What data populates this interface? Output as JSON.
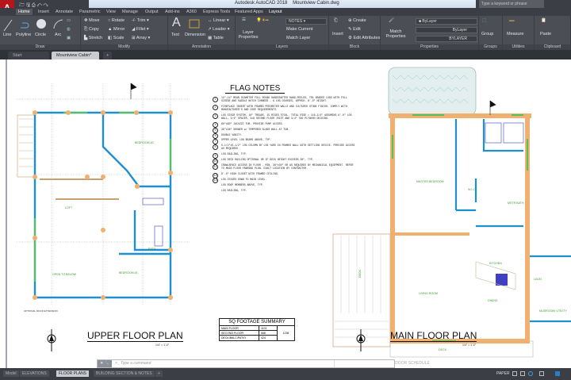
{
  "window": {
    "title": "Autodesk AutoCAD 2018",
    "file": "Mountview Cabin.dwg",
    "search_placeholder": "Type a keyword or phrase",
    "app_letter": "A"
  },
  "ribbon_tabs": [
    "Home",
    "Insert",
    "Annotate",
    "Parametric",
    "View",
    "Manage",
    "Output",
    "Add-ins",
    "A360",
    "Express Tools",
    "Featured Apps",
    "Layout"
  ],
  "panels": {
    "draw": {
      "label": "Draw",
      "buttons": [
        "Line",
        "Polyline",
        "Circle",
        "Arc"
      ]
    },
    "modify": {
      "label": "Modify",
      "buttons": [
        "Move",
        "Rotate",
        "Trim",
        "Copy",
        "Mirror",
        "Fillet",
        "Stretch",
        "Scale",
        "Array"
      ]
    },
    "annotation": {
      "label": "Annotation",
      "buttons": [
        "Text",
        "Dimension",
        "Linear",
        "Leader",
        "Table"
      ]
    },
    "layers": {
      "label": "Layers",
      "buttons": [
        "Layer Properties",
        "Make Current",
        "Match Layer"
      ],
      "layer_value": "NOTES"
    },
    "block": {
      "label": "Block",
      "buttons": [
        "Insert",
        "Create",
        "Edit",
        "Edit Attributes"
      ]
    },
    "properties": {
      "label": "Properties",
      "buttons": [
        "Match Properties"
      ],
      "color": "ByLayer",
      "linetype": "ByLayer",
      "lineweight": "BYLAYER"
    },
    "groups": {
      "label": "Groups",
      "buttons": [
        "Group"
      ]
    },
    "utilities": {
      "label": "Utilities",
      "buttons": [
        "Measure"
      ]
    },
    "clipboard": {
      "label": "Clipboard",
      "buttons": [
        "Paste"
      ]
    }
  },
  "doc_tabs": [
    "Start",
    "Mountview Cabin*"
  ],
  "flag_notes": {
    "title": "FLAG NOTES",
    "notes": [
      {
        "n": "1",
        "text": "12\"-14\" MEAN DIAMETER FULL ROUND HANDCRAFTED HAND-PEELED, TR1 GRADED LOGS WITH FULL SCRIBE AND SADDLE NOTCH CORNERS - 8 LOG COURSES, APPROX. 8'-0\" HEIGHT."
      },
      {
        "n": "2",
        "text": "FIREPLACE INSERT WITH FRAMED PERIMETER WALLS AND CULTURED STONE FINISH. COMPLY WITH MANUFACTURER'S AND CODE REQUIREMENTS."
      },
      {
        "n": "3",
        "text": "LOG STAIR SYSTEM. 10\" TREADS. 15 RISES TOTAL. TOTAL RISE = 116-3/4\" ASSUMING 8'-0\" LOG WALL, 3/4\" SPACER, 2x8 SECOND FLOOR JOIST AND 3/4\" T&G PLYWOOD DECKING."
      },
      {
        "n": "4",
        "text": "60\"x60\" JACUZZI TUB. PROVIDE PUMP ACCESS."
      },
      {
        "n": "5",
        "text": "36\"x36\" SHOWER w/ TEMPERED GLASS WALL AT TUB."
      },
      {
        "n": "6",
        "text": "DOUBLE VANITY."
      },
      {
        "n": "7",
        "text": "UPPER LEVEL LOG BEAMS ABOVE, TYP."
      },
      {
        "n": "8",
        "text": "5-1/2\"x5-1/2\" LOG COLUMN BY LOG YARD IN FRAMED WALL WITH SETTLING DEVICE. PROVIDE ACCESS AS REQUIRED."
      },
      {
        "n": "9",
        "text": "LOG RAILING, TYP."
      },
      {
        "n": "10",
        "text": "LOG DECK RAILING OPTIONAL OR IF DECK HEIGHT EXCEEDS 30\", TYP."
      },
      {
        "n": "11",
        "text": "CRAWLSPACE ACCESS IN FLOOR - MIN. 30\"x30\" OR AS REQUIRED BY MECHANICAL EQUIPMENT. REFER TO MAIN FLOOR FRAMING PLAN. EXACT LOCATION BY CONTRACTOR."
      },
      {
        "n": "12",
        "text": "8'-0\" HIGH CLOSET WITH FRAMED CEILING."
      },
      {
        "n": "13",
        "text": "LOG STAIRS DOWN TO MAIN LEVEL."
      },
      {
        "n": "",
        "text": "LOG ROOF MEMBERS ABOVE, TYP."
      },
      {
        "n": "",
        "text": "LOG RAILING, TYP."
      }
    ]
  },
  "sq_footage": {
    "title": "SQ FOOTAGE SUMMARY",
    "rows": [
      [
        "MAIN FLOOR",
        "1101"
      ],
      [
        "SECOND FLOOR",
        "668"
      ],
      [
        "DECK/BALC/PATIO",
        "424"
      ]
    ],
    "total": "1236"
  },
  "plans": {
    "upper": {
      "title": "UPPER FLOOR PLAN",
      "scale": "1/4\" = 1'-0\"",
      "rooms": [
        "LOFT",
        "BEDROOM #2",
        "BATH",
        "OPEN TO BELOW",
        "BEDROOM #1"
      ],
      "note": "OPTIONAL ROOF EXTENSION"
    },
    "main": {
      "title": "MAIN FLOOR PLAN",
      "scale": "1/4\" = 1'-0\"",
      "rooms": [
        "MASTER BEDROOM",
        "W.I.C.",
        "MSTR BATH",
        "KITCHEN",
        "LIVING ROOM",
        "DINING",
        "LAUN.",
        "MUDROOM/ UTILITY",
        "DECK",
        "DECK"
      ]
    }
  },
  "command": {
    "placeholder": "Type a command",
    "right_label": "DOOR SCHEDULE",
    "close": "✕"
  },
  "layout_tabs": [
    "Model",
    "ELEVATIONS",
    "FLOOR PLANS",
    "BUILDING SECTION & NOTES",
    "+"
  ],
  "status": {
    "space": "PAPER"
  },
  "colors": {
    "wall": "#1e8fd0",
    "log": "#f0b070",
    "window": "#58c05a",
    "ribbon": "#4b4f55"
  }
}
